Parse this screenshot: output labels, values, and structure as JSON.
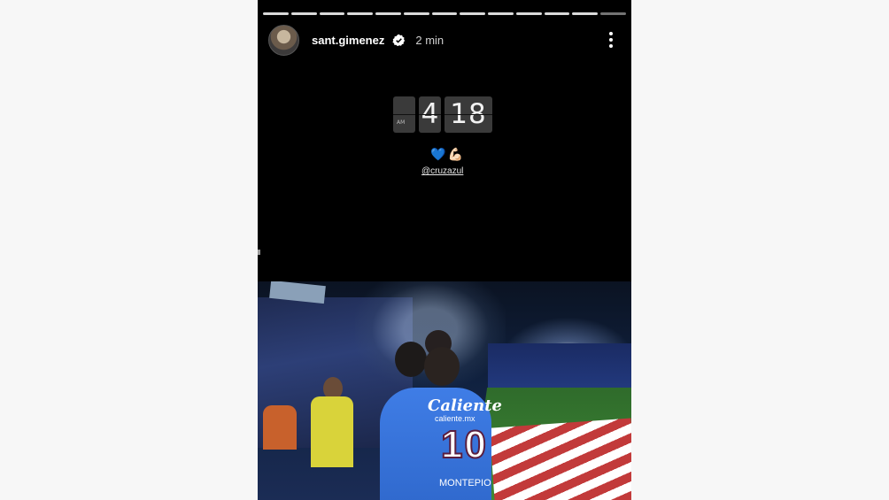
{
  "story": {
    "progress_segments": 13,
    "header": {
      "username": "sant.gimenez",
      "verified": true,
      "timestamp": "2 min",
      "avatar_icon": "avatar-icon",
      "menu_icon": "more-vertical-icon"
    },
    "clock": {
      "ampm": "AM",
      "hour": "4",
      "minutes": "18"
    },
    "emojis": [
      "💙",
      "💪🏻"
    ],
    "mention": "@cruzazul",
    "photo": {
      "sponsor": "Caliente",
      "sponsor_sub": "caliente.mx",
      "jersey_number": "10",
      "sponsor2": "MONTEPIO"
    }
  }
}
